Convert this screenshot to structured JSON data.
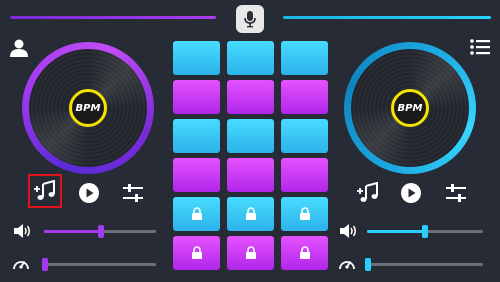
{
  "app": {
    "deck_label": "BPM"
  },
  "colors": {
    "accent_left": "#a33af0",
    "accent_right": "#27d0ff",
    "pad_cyan": "#3fcaf5",
    "pad_pink": "#d43cf7",
    "bpm_ring": "#f2e600",
    "highlight": "#e0151b"
  },
  "icons": [
    "mic-icon",
    "user-icon",
    "menu-icon",
    "add-music-icon",
    "play-icon",
    "equalizer-icon",
    "volume-icon",
    "speed-icon",
    "lock-icon"
  ],
  "decks": {
    "left": {
      "label": "BPM",
      "volume": 0.5,
      "speed": 0.0
    },
    "right": {
      "label": "BPM",
      "volume": 0.5,
      "speed": 0.0
    }
  },
  "pads": {
    "rows": [
      [
        "cyan",
        "cyan",
        "cyan"
      ],
      [
        "pink",
        "pink",
        "pink"
      ],
      [
        "cyan",
        "cyan",
        "cyan"
      ],
      [
        "pink",
        "pink",
        "pink"
      ],
      [
        "cyan-locked",
        "cyan-locked",
        "cyan-locked"
      ],
      [
        "pink-locked",
        "pink-locked",
        "pink-locked"
      ]
    ]
  }
}
